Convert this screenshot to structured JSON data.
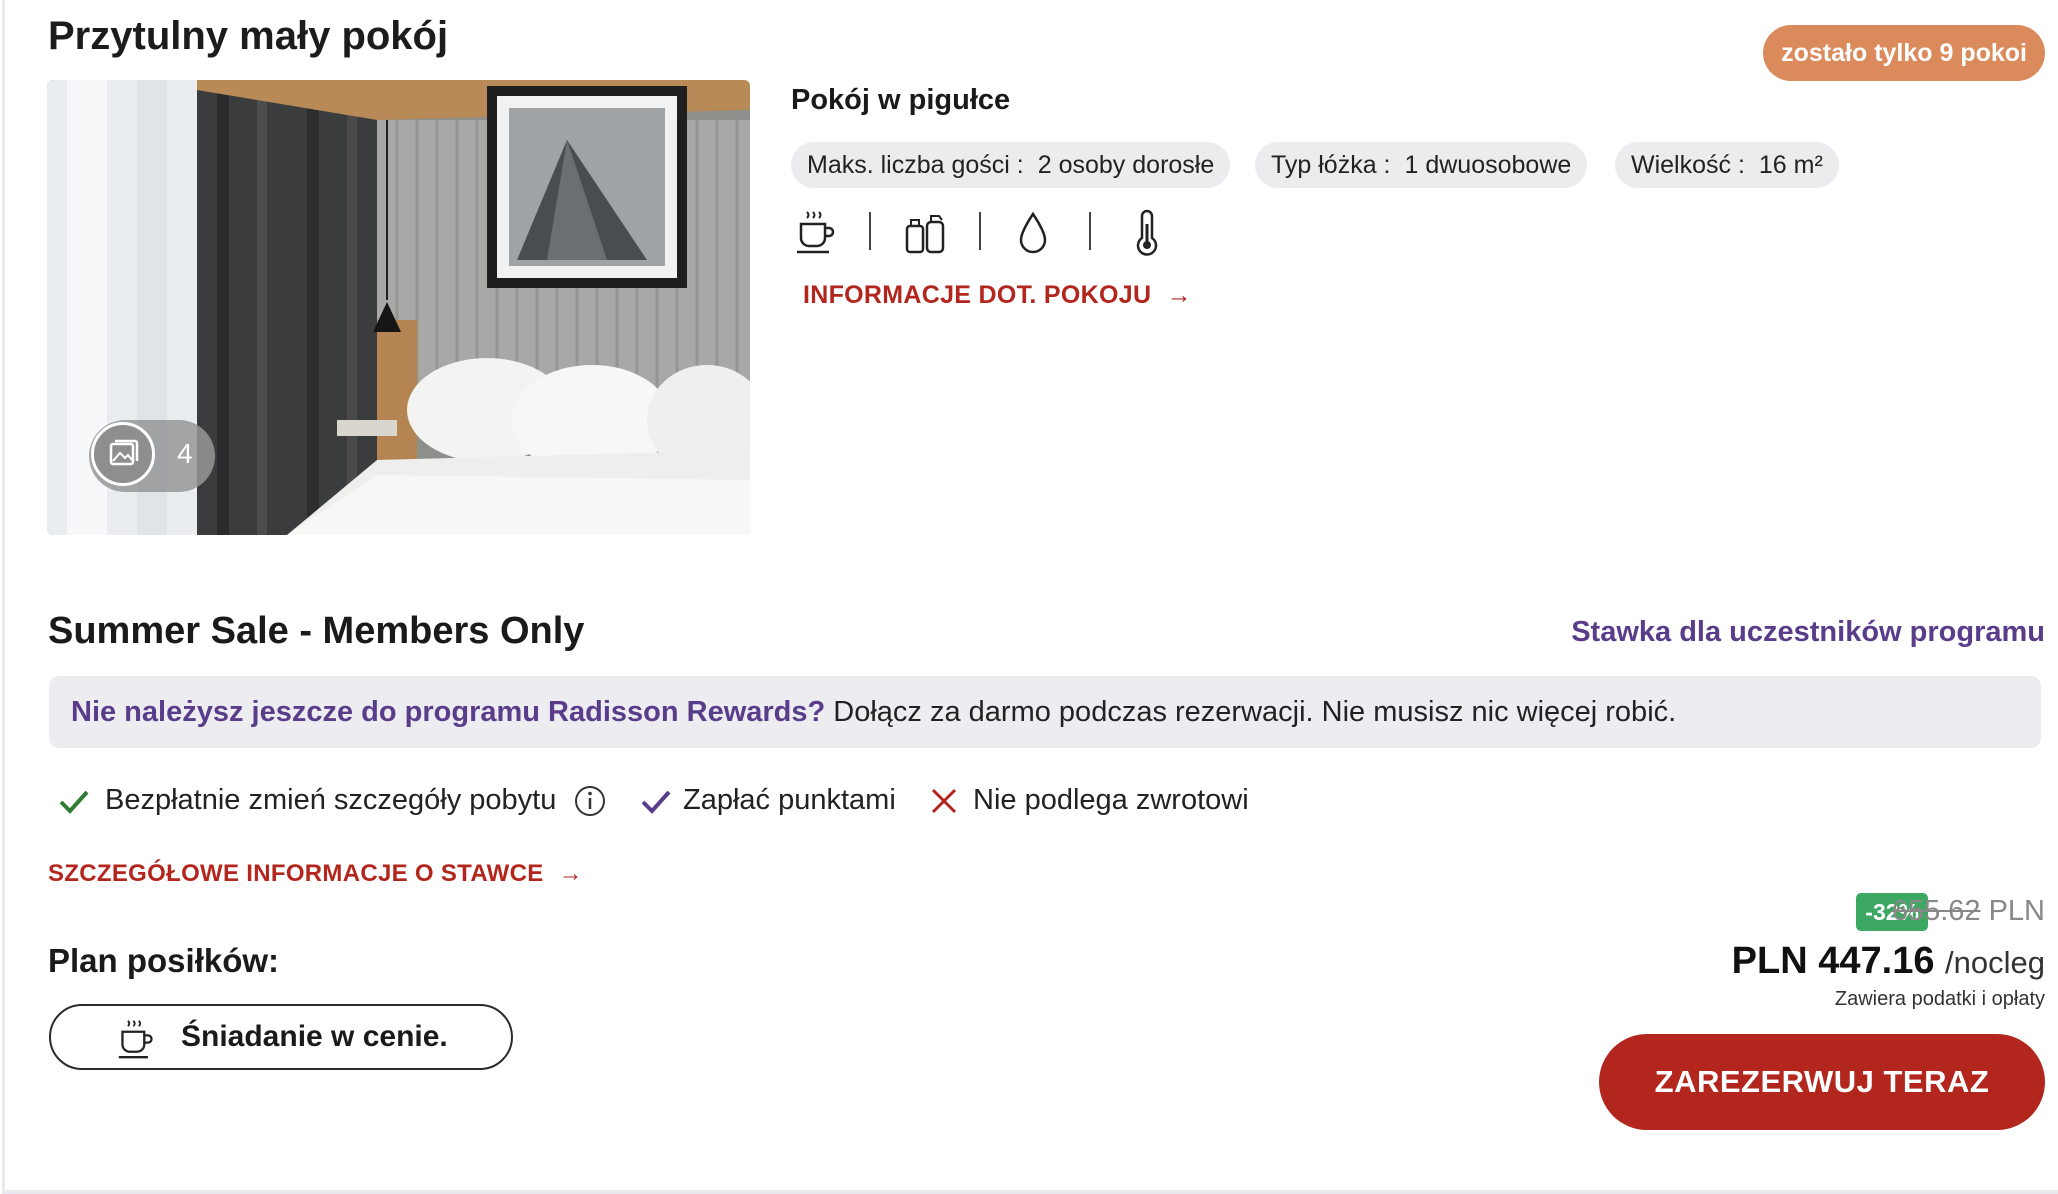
{
  "room": {
    "title": "Przytulny mały pokój",
    "rooms_left": "zostało tylko 9 pokoi",
    "photo_count": "4"
  },
  "nutshell": {
    "title": "Pokój w pigułce",
    "guests_label": "Maks. liczba gości :",
    "guests_value": "2 osoby dorosłe",
    "bed_label": "Typ łóżka :",
    "bed_value": "1 dwuosobowe",
    "size_label": "Wielkość :",
    "size_value": "16 m²",
    "amenity_icons": [
      "coffee-icon",
      "toiletries-icon",
      "water-drop-icon",
      "thermometer-icon"
    ],
    "room_info_link": "INFORMACJE DOT. POKOJU"
  },
  "rate": {
    "title": "Summer Sale - Members Only",
    "member_rate_label": "Stawka dla uczestników programu",
    "banner_bold": "Nie należysz jeszcze do programu Radisson Rewards?",
    "banner_text": " Dołącz za darmo podczas rezerwacji. Nie musisz nic więcej robić.",
    "features": [
      {
        "label": "Bezpłatnie zmień szczegóły pobytu",
        "icon": "check-icon"
      },
      {
        "label": "Zapłać punktami",
        "icon": "check-icon"
      },
      {
        "label": "Nie podlega zwrotowi",
        "icon": "cross-icon"
      }
    ],
    "details_link": "SZCZEGÓŁOWE INFORMACJE O STAWCE"
  },
  "meals": {
    "title": "Plan posiłków:",
    "option": "Śniadanie w cenie."
  },
  "pricing": {
    "discount": "-32%",
    "old_price": "655.62",
    "old_currency": "PLN",
    "price": "PLN 447.16",
    "per": "/nocleg",
    "taxes_note": "Zawiera podatki i opłaty",
    "book_button": "ZAREZERWUJ TERAZ"
  },
  "colors": {
    "accent_red": "#b3261e",
    "purple": "#5a3d8a",
    "badge_orange": "#db8a5b",
    "discount_green": "#3da863",
    "check_green": "#2e7d32"
  }
}
